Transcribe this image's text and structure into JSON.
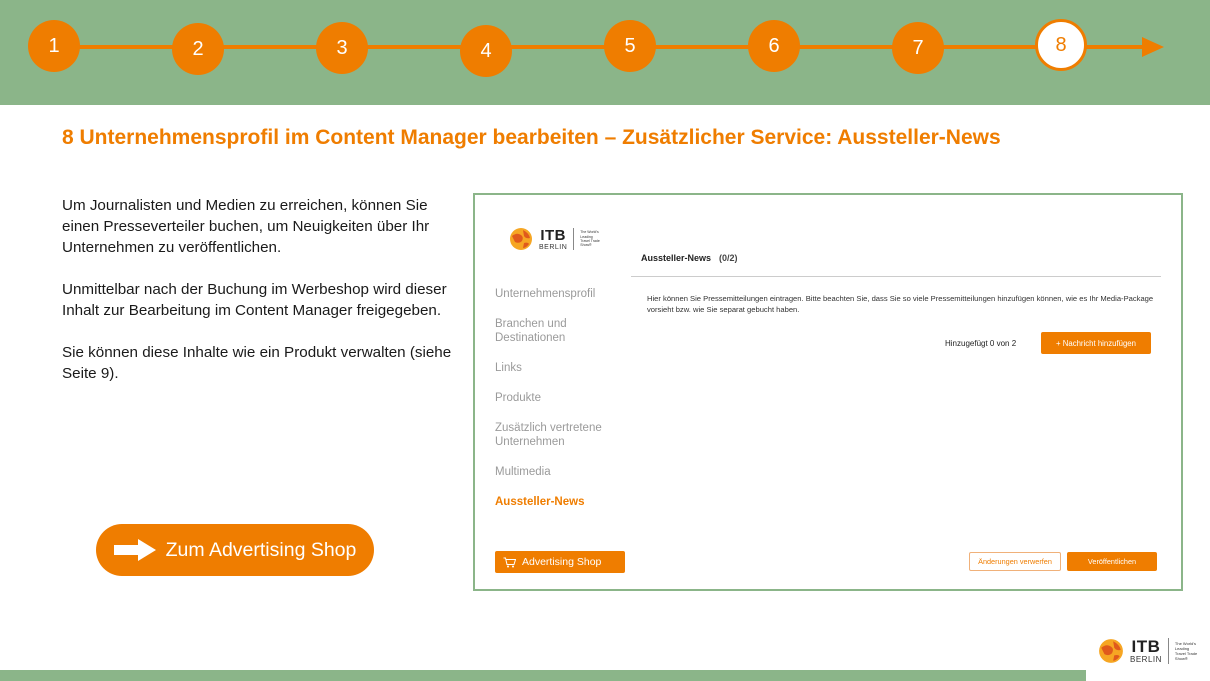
{
  "steps": [
    "1",
    "2",
    "3",
    "4",
    "5",
    "6",
    "7",
    "8"
  ],
  "current_step": "8",
  "colors": {
    "accent": "#ef7d00",
    "band": "#8bb589"
  },
  "title": "8 Unternehmensprofil im Content Manager bearbeiten – Zusätzlicher Service: Aussteller-News",
  "paragraphs": [
    "Um Journalisten und Medien zu erreichen, können Sie einen Presseverteiler buchen, um Neuigkeiten über Ihr Unternehmen zu veröffentlichen.",
    "Unmittelbar nach der Buchung im Werbeshop wird dieser Inhalt zur Bearbeitung im Content Manager freigegeben.",
    "Sie können diese Inhalte wie ein Produkt verwalten (siehe Seite 9)."
  ],
  "cta": {
    "label": "Zum Advertising Shop",
    "icon": "arrow-right-icon"
  },
  "logo": {
    "name": "ITB",
    "city": "BERLIN",
    "tagline": "The World's Leading Travel Trade Show®"
  },
  "screen": {
    "nav": [
      {
        "label": "Unternehmensprofil",
        "active": false
      },
      {
        "label": "Branchen und Destinationen",
        "active": false
      },
      {
        "label": "Links",
        "active": false
      },
      {
        "label": "Produkte",
        "active": false
      },
      {
        "label": "Zusätzlich vertretene Unternehmen",
        "active": false
      },
      {
        "label": "Multimedia",
        "active": false
      },
      {
        "label": "Aussteller-News",
        "active": true
      }
    ],
    "shop_button": "Advertising Shop",
    "panel_title": "Aussteller-News",
    "panel_count": "(0/2)",
    "description": "Hier können Sie Pressemitteilungen eintragen. Bitte beachten Sie, dass Sie so viele Pressemitteilungen hinzufügen können, wie es Ihr Media-Package vorsieht bzw. wie Sie separat gebucht haben.",
    "added_label": "Hinzugefügt 0 von 2",
    "add_button": "+ Nachricht hinzufügen",
    "discard_button": "Änderungen verwerfen",
    "publish_button": "Veröffentlichen"
  }
}
